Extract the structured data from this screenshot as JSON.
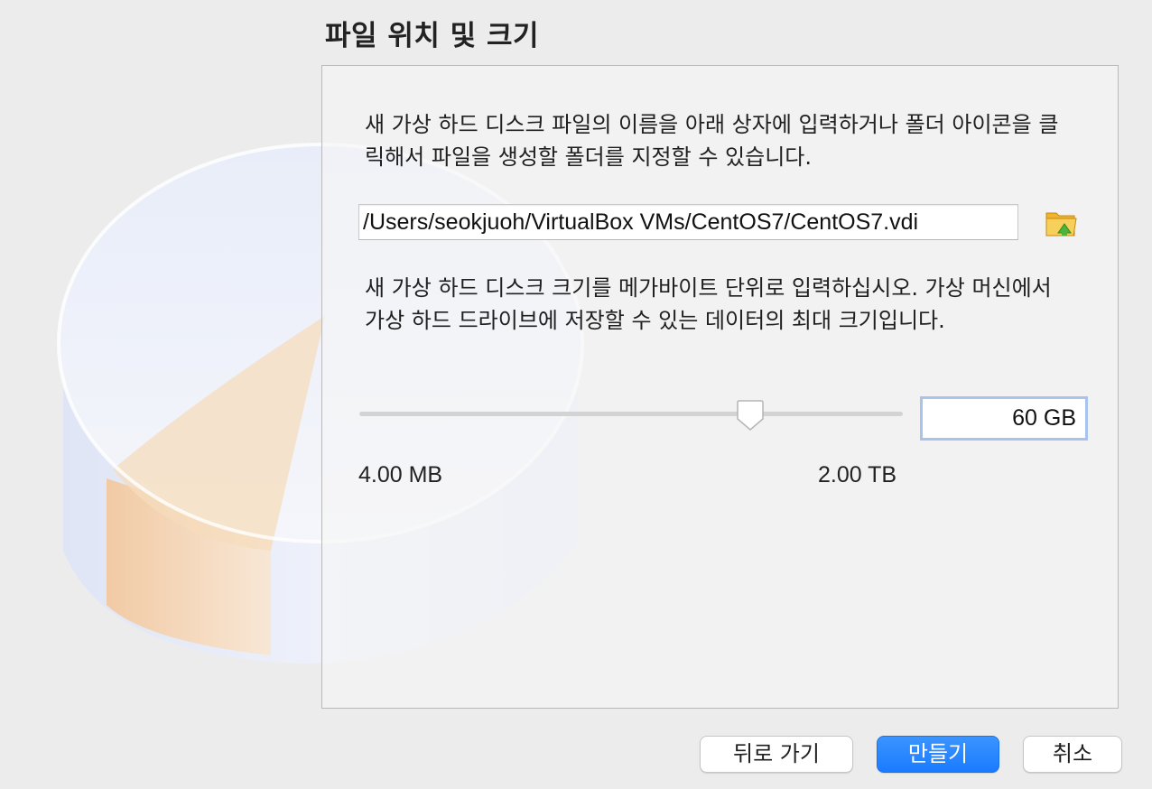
{
  "page": {
    "title": "파일 위치 및 크기"
  },
  "location": {
    "description": "새 가상 하드 디스크 파일의 이름을 아래 상자에 입력하거나 폴더 아이콘을 클릭해서 파일을 생성할 폴더를 지정할 수 있습니다.",
    "path_value": "/Users/seokjuoh/VirtualBox VMs/CentOS7/CentOS7.vdi",
    "folder_icon": "folder-open-icon"
  },
  "size": {
    "description": "새 가상 하드 디스크 크기를 메가바이트 단위로 입력하십시오. 가상 머신에서 가상 하드 드라이브에 저장할 수 있는 데이터의 최대 크기입니다.",
    "value": "60 GB",
    "min_label": "4.00 MB",
    "max_label": "2.00 TB",
    "slider_fraction": 0.72
  },
  "buttons": {
    "back": "뒤로 가기",
    "create": "만들기",
    "cancel": "취소"
  },
  "colors": {
    "accent": "#1a7bff",
    "window_bg": "#ececec",
    "focus_ring": "#a8c4ec"
  }
}
